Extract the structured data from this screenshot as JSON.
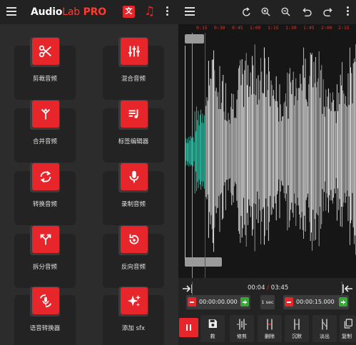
{
  "left": {
    "brand": {
      "name": "Audio",
      "lab": "Lab",
      "pro": " PRO"
    },
    "translate_glyph": "文",
    "music_glyph": "♫",
    "tools": [
      {
        "label": "剪裁音频",
        "icon": "scissors-icon"
      },
      {
        "label": "混合音频",
        "icon": "mixer-icon"
      },
      {
        "label": "合并音频",
        "icon": "merge-icon"
      },
      {
        "label": "标签编辑器",
        "icon": "tag-editor-icon"
      },
      {
        "label": "转换音频",
        "icon": "convert-icon"
      },
      {
        "label": "录制音频",
        "icon": "microphone-icon"
      },
      {
        "label": "拆分音频",
        "icon": "split-icon"
      },
      {
        "label": "反向音频",
        "icon": "reverse-icon"
      },
      {
        "label": "语音转换器",
        "icon": "voice-changer-icon"
      },
      {
        "label": "添加 sfx",
        "icon": "sparkles-icon"
      }
    ]
  },
  "right": {
    "toolbar_icons": [
      "menu-icon",
      "redo-rotate-icon",
      "zoom-in-icon",
      "zoom-out-icon",
      "undo-icon",
      "redo-icon",
      "more-icon"
    ],
    "ruler": [
      "0:15",
      "0:30",
      "0:45",
      "1:00",
      "1:15",
      "1:30",
      "1:45",
      "2:00",
      "2:15"
    ],
    "accent": "#e7262b",
    "waveform_color": "#ffffff",
    "selection_color": "#2ee0c0",
    "time": {
      "current": "00:04",
      "separator": "/",
      "total": "03:45"
    },
    "start_field": "00:00:00.000",
    "step": "1 sec",
    "end_field": "00:00:15.000",
    "actions": [
      {
        "label": "",
        "icon": "pause-icon"
      },
      {
        "label": "救",
        "icon": "save-icon"
      },
      {
        "label": "修剪",
        "icon": "trim-icon"
      },
      {
        "label": "删除",
        "icon": "delete-icon"
      },
      {
        "label": "沉默",
        "icon": "silence-icon"
      },
      {
        "label": "淡出",
        "icon": "fade-out-icon"
      },
      {
        "label": "复制",
        "icon": "copy-icon"
      }
    ]
  }
}
